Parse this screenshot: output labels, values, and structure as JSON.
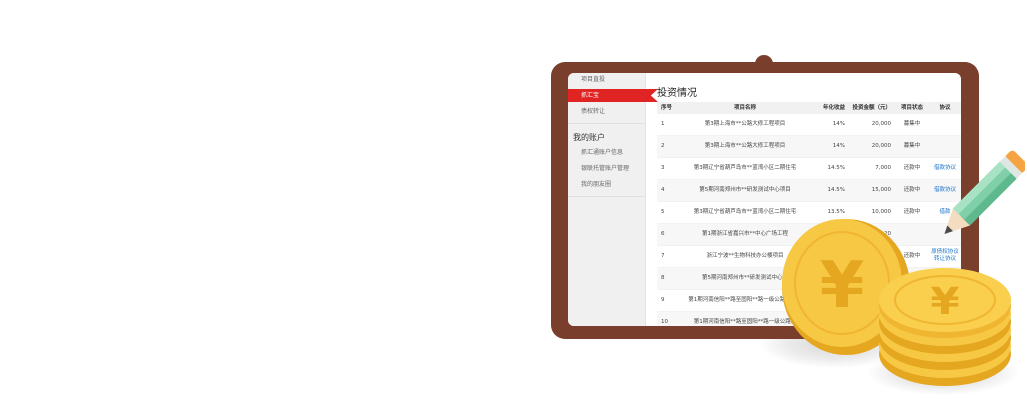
{
  "sidebar": {
    "items_top": [
      {
        "label": "项目直投",
        "active": false
      },
      {
        "label": "抓汇宝",
        "active": true
      },
      {
        "label": "债权转让",
        "active": false
      }
    ],
    "account_title": "我的账户",
    "items_account": [
      {
        "label": "抓汇通账户信息"
      },
      {
        "label": "银联托管账户管理"
      },
      {
        "label": "我的朋友圈"
      }
    ]
  },
  "main": {
    "title": "投资情况",
    "columns": [
      "序号",
      "项目名称",
      "年化收益",
      "投资金额（元）",
      "项目状态",
      "协议"
    ],
    "rows": [
      {
        "index": "1",
        "name": "第3期上海市**公路大修工程项目",
        "rate": "14%",
        "amount": "20,000",
        "status": "募集中",
        "agreement": ""
      },
      {
        "index": "2",
        "name": "第3期上海市**公路大修工程项目",
        "rate": "14%",
        "amount": "20,000",
        "status": "募集中",
        "agreement": ""
      },
      {
        "index": "3",
        "name": "第3期辽宁省葫芦岛市**蓝湾小区二期住宅",
        "rate": "14.5%",
        "amount": "7,000",
        "status": "还款中",
        "agreement": "借款协议"
      },
      {
        "index": "4",
        "name": "第5期河南郑州市**研发测试中心项目",
        "rate": "14.5%",
        "amount": "15,000",
        "status": "还款中",
        "agreement": "借款协议"
      },
      {
        "index": "5",
        "name": "第3期辽宁省葫芦岛市**蓝湾小区二期住宅",
        "rate": "13.5%",
        "amount": "10,000",
        "status": "还款中",
        "agreement": "借款"
      },
      {
        "index": "6",
        "name": "第1期浙江省嘉兴市**中心广场工程",
        "rate": "",
        "amount": "20",
        "status": "",
        "agreement": ""
      },
      {
        "index": "7",
        "name": "浙江宁波**生物科技办公楼项目",
        "rate": "",
        "amount": "",
        "status": "还款中",
        "agreement_lines": [
          "原债权协议",
          "转让协议"
        ]
      },
      {
        "index": "8",
        "name": "第5期河南郑州市**研发测试中心项",
        "rate": "",
        "amount": "",
        "status": "",
        "agreement": ""
      },
      {
        "index": "9",
        "name": "第1期河南信阳**路至固阳**路一级公路连接线",
        "rate": "",
        "amount": "",
        "status": "",
        "agreement": ""
      },
      {
        "index": "10",
        "name": "第1期河南信阳**路至固阳**路一级公路连",
        "rate": "",
        "amount": "",
        "status": "",
        "agreement": ""
      }
    ]
  },
  "decor": {
    "coin_symbol": "¥",
    "icons": [
      "pencil-icon",
      "yuan-coin-icon",
      "yuan-coin-stack-icon"
    ],
    "colors": {
      "folder": "#7a3f2c",
      "accent_red": "#e02424",
      "coin_gold": "#f7c843",
      "coin_dark": "#e5a620",
      "pencil_green": "#7fd0a8",
      "link_blue": "#1a73c9"
    }
  }
}
